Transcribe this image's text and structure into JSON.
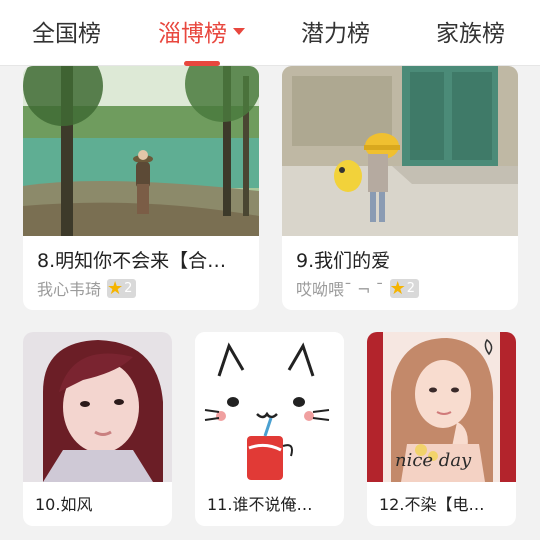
{
  "tabs": [
    {
      "label": "全国榜"
    },
    {
      "label": "淄博榜"
    },
    {
      "label": "潜力榜"
    },
    {
      "label": "家族榜"
    }
  ],
  "cards": [
    {
      "title": "8.明知你不会来【合…",
      "author": "我心韦琦",
      "rank": "2"
    },
    {
      "title": "9.我们的爱",
      "author": "哎呦喂¯ ¬ ¯",
      "rank": "2"
    },
    {
      "title": "10.如风"
    },
    {
      "title": "11.谁不说俺…"
    },
    {
      "title": "12.不染【电…",
      "signature": "nice day"
    }
  ],
  "colors": {
    "accent": "#e8473e",
    "star": "#f5b400"
  }
}
